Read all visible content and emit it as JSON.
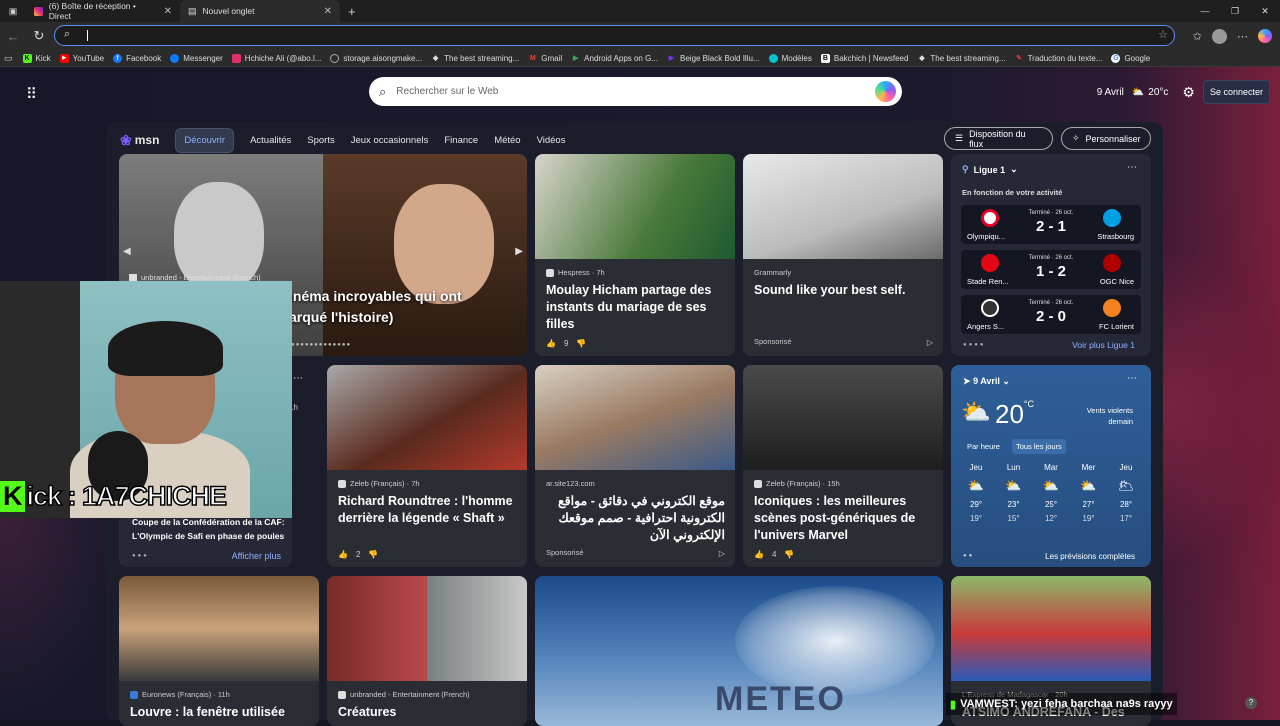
{
  "tabs": [
    {
      "label": "(6) Boîte de réception • Direct",
      "icon": "instagram-icon"
    },
    {
      "label": "Nouvel onglet",
      "icon": "newtab-icon"
    }
  ],
  "bookmarks": [
    {
      "label": "Kick",
      "color": "#53fc18"
    },
    {
      "label": "YouTube",
      "color": "#ff0000"
    },
    {
      "label": "Facebook",
      "color": "#1877f2"
    },
    {
      "label": "Messenger",
      "color": "#0a7cff"
    },
    {
      "label": "Hchiche Ali (@abo.l...",
      "color": "#e1306c"
    },
    {
      "label": "storage.aisongmake...",
      "color": "#888888"
    },
    {
      "label": "The best streaming...",
      "color": "#cccccc"
    },
    {
      "label": "Gmail",
      "color": "#ea4335"
    },
    {
      "label": "Android Apps on G...",
      "color": "#34a853"
    },
    {
      "label": "Beige Black Bold Illu...",
      "color": "#7b2ff7"
    },
    {
      "label": "Modèles",
      "color": "#00c4cc"
    },
    {
      "label": "Bakchich | Newsfeed",
      "color": "#ffffff"
    },
    {
      "label": "The best streaming...",
      "color": "#cccccc"
    },
    {
      "label": "Traduction du texte...",
      "color": "#d33b2c"
    },
    {
      "label": "Google",
      "color": "#4285f4"
    }
  ],
  "search": {
    "placeholder": "Rechercher sur le Web"
  },
  "header": {
    "date": "9 Avril",
    "temp": "20°c",
    "signin": "Se connecter"
  },
  "msn": {
    "logo": "msn",
    "nav": [
      "Découvrir",
      "Actualités",
      "Sports",
      "Jeux occasionnels",
      "Finance",
      "Météo",
      "Vidéos"
    ],
    "layout_btn": "Disposition du flux",
    "personalize_btn": "Personnaliser"
  },
  "hero": {
    "source": "unbranded - Entertainment (French)",
    "title_line1": "inéma incroyables qui ont",
    "title_line2": "arqué l'histoire)"
  },
  "cards": {
    "c1": {
      "source": "Hespress · 7h",
      "title": "Moulay Hicham partage des instants du mariage de ses filles",
      "likes": "9"
    },
    "c2": {
      "source": "Grammarly",
      "title": "Sound like your best self.",
      "sponsored": "Sponsorisé"
    },
    "c3": {
      "source": "Zeleb (Français) · 7h",
      "title": "Richard Roundtree : l'homme derrière la légende « Shaft »",
      "likes": "2"
    },
    "c4": {
      "source": "ar.site123.com",
      "title": "موقع الكتروني في دقائق - مواقع الكترونية احترافية - صمم موقعك الإلكتروني الآن",
      "sponsored": "Sponsorisé"
    },
    "c5": {
      "source": "Zeleb (Français) · 15h",
      "title": "Iconiques : les meilleures scènes post-génériques de l'univers Marvel",
      "likes": "4"
    },
    "c6": {
      "source": "Euronews (Français) · 11h",
      "title": "Louvre : la fenêtre utilisée"
    },
    "c7": {
      "source": "unbranded - Entertainment (French)",
      "title": "Créatures"
    },
    "c8": {
      "source": "L'Express de Madagascar · 20h",
      "title": "ATSIMO ANDREFANA - Des"
    }
  },
  "culture": {
    "time": "1h",
    "title": "Coupe de la Confédération de la CAF: L'Olympic de Safi en phase de poules",
    "more": "Afficher plus"
  },
  "ligue": {
    "title": "Ligue 1",
    "subtitle": "En fonction de votre activité",
    "matches": [
      {
        "status": "Terminé · 26 oct.",
        "score": "2 - 1",
        "home": "Olympiqu...",
        "away": "Strasbourg",
        "home_color": "#e4002b",
        "away_color": "#00a1e4"
      },
      {
        "status": "Terminé · 26 oct.",
        "score": "1 - 2",
        "home": "Stade Ren...",
        "away": "OGC Nice",
        "home_color": "#e30613",
        "away_color": "#b00000"
      },
      {
        "status": "Terminé · 26 oct.",
        "score": "2 - 0",
        "home": "Angers S...",
        "away": "FC Lorient",
        "home_color": "#333333",
        "away_color": "#f58220"
      }
    ],
    "more": "Voir plus Ligue 1"
  },
  "weather": {
    "date": "9 Avril",
    "temp": "20",
    "unit": "°C",
    "wind": "Vents violents",
    "wind2": "demain",
    "tab1": "Par heure",
    "tab2": "Tous les jours",
    "days": [
      {
        "d": "Jeu",
        "hi": "29°",
        "lo": "19°"
      },
      {
        "d": "Lun",
        "hi": "23°",
        "lo": "15°"
      },
      {
        "d": "Mar",
        "hi": "25°",
        "lo": "12°"
      },
      {
        "d": "Mer",
        "hi": "27°",
        "lo": "19°"
      },
      {
        "d": "Jeu",
        "hi": "28°",
        "lo": "17°"
      }
    ],
    "full": "Les prévisions complètes"
  },
  "stream": {
    "kick_label": "ick : 1A7CHICHE",
    "kick_letter": "K",
    "chat": "VAMWEST: yezi feha barchaa na9s rayyy"
  },
  "meteo_banner": "METEO"
}
